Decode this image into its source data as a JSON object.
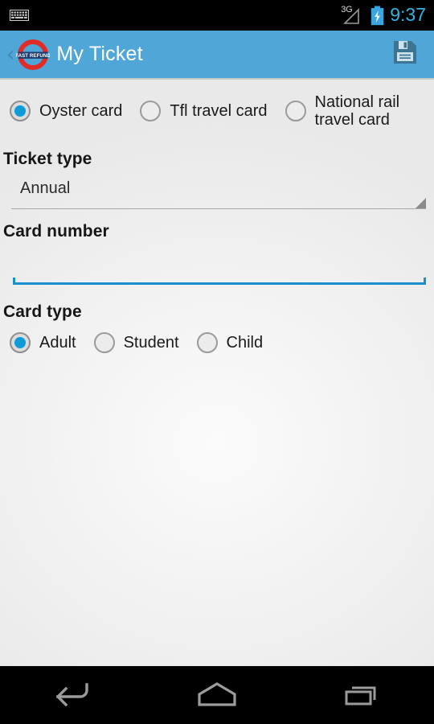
{
  "status_bar": {
    "keyboard_icon": "keyboard-icon",
    "network_label": "3G",
    "signal_icon": "signal-triangle-icon",
    "battery_icon": "battery-charging-icon",
    "time": "9:37"
  },
  "action_bar": {
    "back_icon": "back-chevron-icon",
    "back_glyph": "‹",
    "logo": {
      "name": "fast-refund-roundel-logo",
      "text": "FAST REFUND",
      "ring_color": "#e02b26",
      "bar_color": "#1c3b6e"
    },
    "title": "My Ticket",
    "save_icon": "save-floppy-icon",
    "background_color": "#50a7d7"
  },
  "form": {
    "card_source": {
      "name": "card-source-radio-group",
      "options": [
        {
          "label": "Oyster card",
          "selected": true
        },
        {
          "label": "Tfl travel card",
          "selected": false
        },
        {
          "label": "National rail travel card",
          "selected": false
        }
      ]
    },
    "ticket_type": {
      "label": "Ticket type",
      "selected_value": "Annual",
      "caret_icon": "dropdown-caret-icon"
    },
    "card_number": {
      "label": "Card number",
      "value": "",
      "placeholder": ""
    },
    "card_type": {
      "label": "Card type",
      "options": [
        {
          "label": "Adult",
          "selected": true
        },
        {
          "label": "Student",
          "selected": false
        },
        {
          "label": "Child",
          "selected": false
        }
      ]
    }
  },
  "nav_bar": {
    "back_icon": "nav-back-icon",
    "home_icon": "nav-home-icon",
    "recents_icon": "nav-recents-icon"
  },
  "colors": {
    "accent_blue": "#0f9bd7",
    "action_bar": "#50a7d7",
    "clock_blue": "#34b4e4",
    "underline_blue": "#1a8fc9"
  }
}
